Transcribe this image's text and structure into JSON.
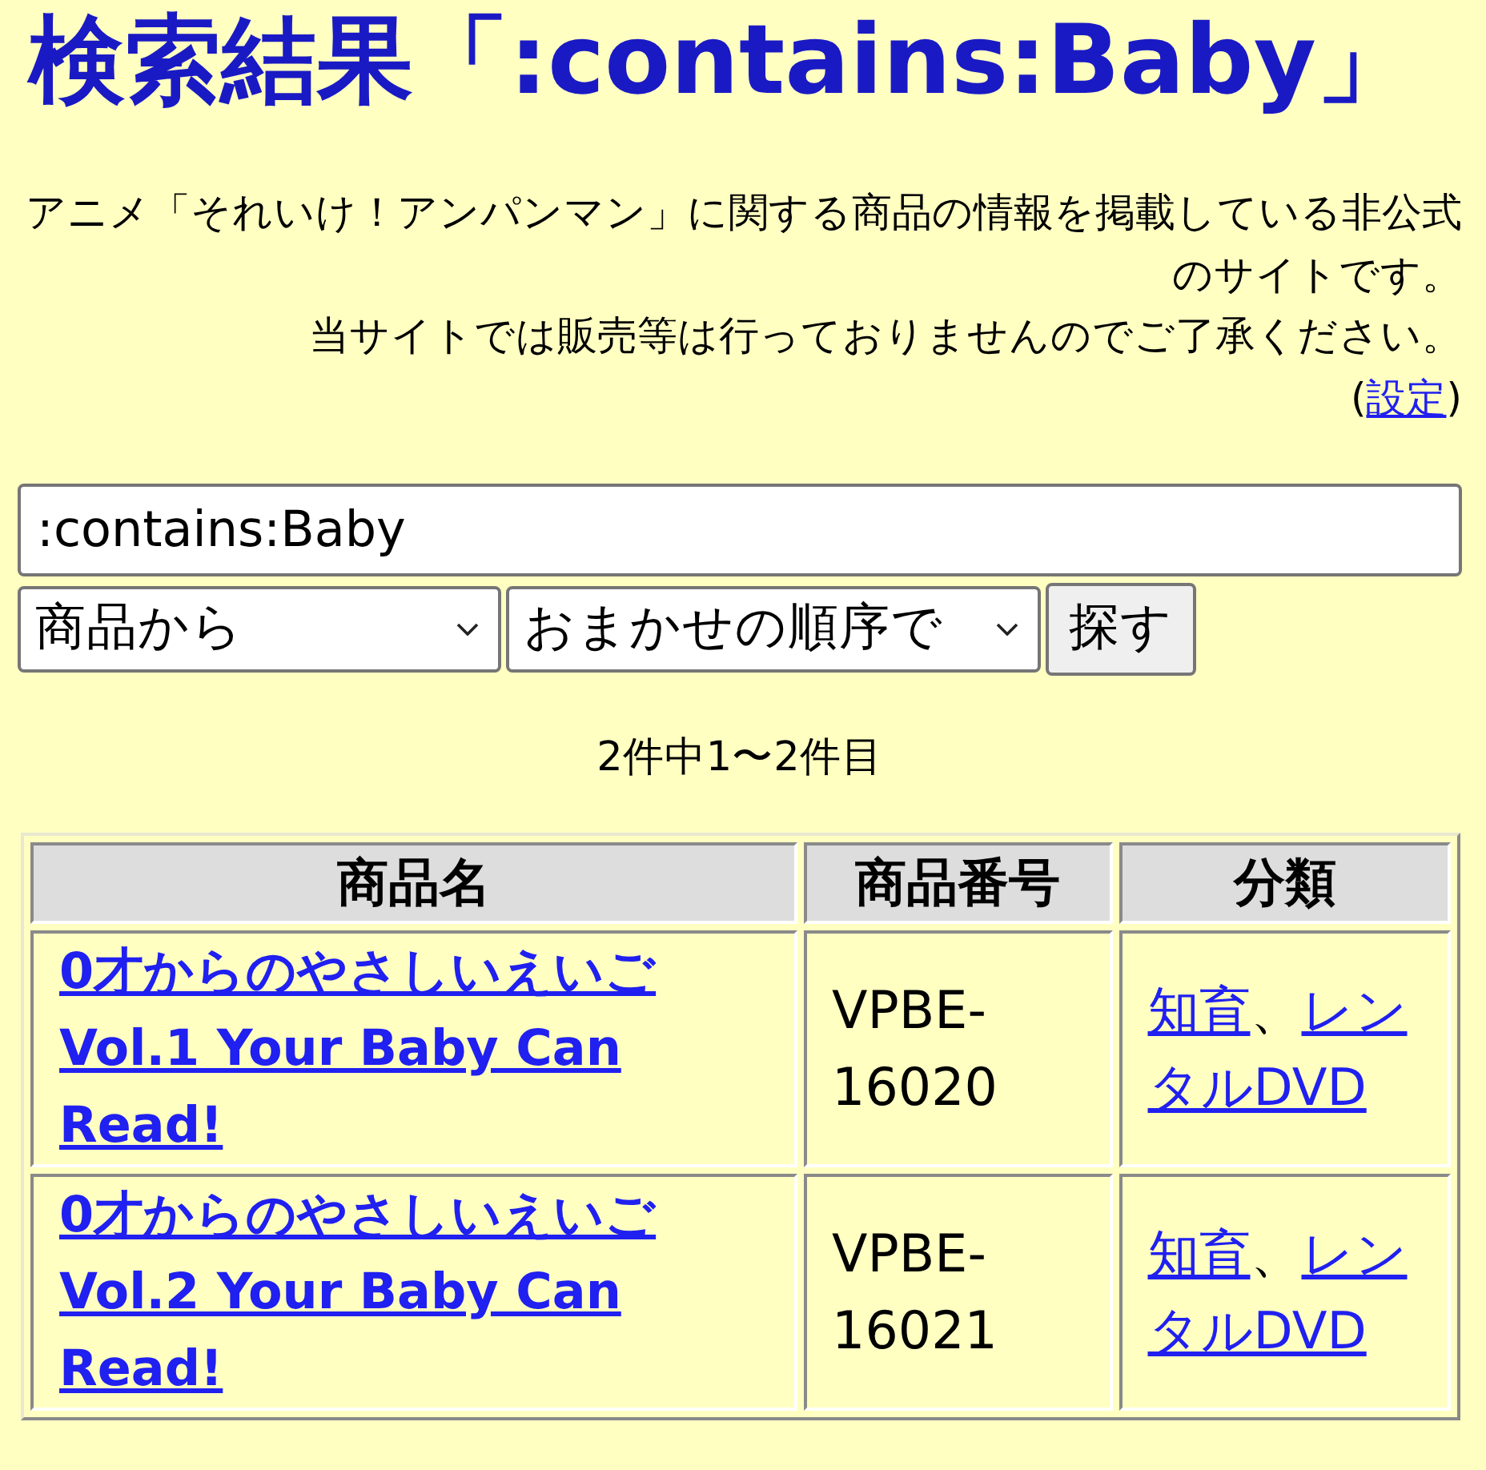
{
  "page": {
    "title": "検索結果「:contains:Baby」"
  },
  "intro": {
    "paragraphs": [
      "アニメ「それいけ！アンパンマン」に関する商品の情報を掲載している非公式のサイトです。",
      "当サイトでは販売等は行っておりませんのでご了承ください。"
    ],
    "settings_note": {
      "before": "(",
      "link": "設定",
      "after": ")"
    }
  },
  "search": {
    "query": ":contains:Baby",
    "scope": "商品から",
    "order": "おまかせの順序で",
    "button": "探す"
  },
  "result_count": "2件中1〜2件目",
  "table": {
    "columns": [
      "商品名",
      "商品番号",
      "分類"
    ],
    "rows": [
      {
        "name": "0才からのやさしいえいご Vol.1 Your Baby Can Read!",
        "number": "VPBE-16020",
        "categories": [
          "知育",
          "レンタルDVD"
        ],
        "separator": "、"
      },
      {
        "name": "0才からのやさしいえいご Vol.2 Your Baby Can Read!",
        "number": "VPBE-16021",
        "categories": [
          "知育",
          "レンタルDVD"
        ],
        "separator": "、"
      }
    ]
  }
}
